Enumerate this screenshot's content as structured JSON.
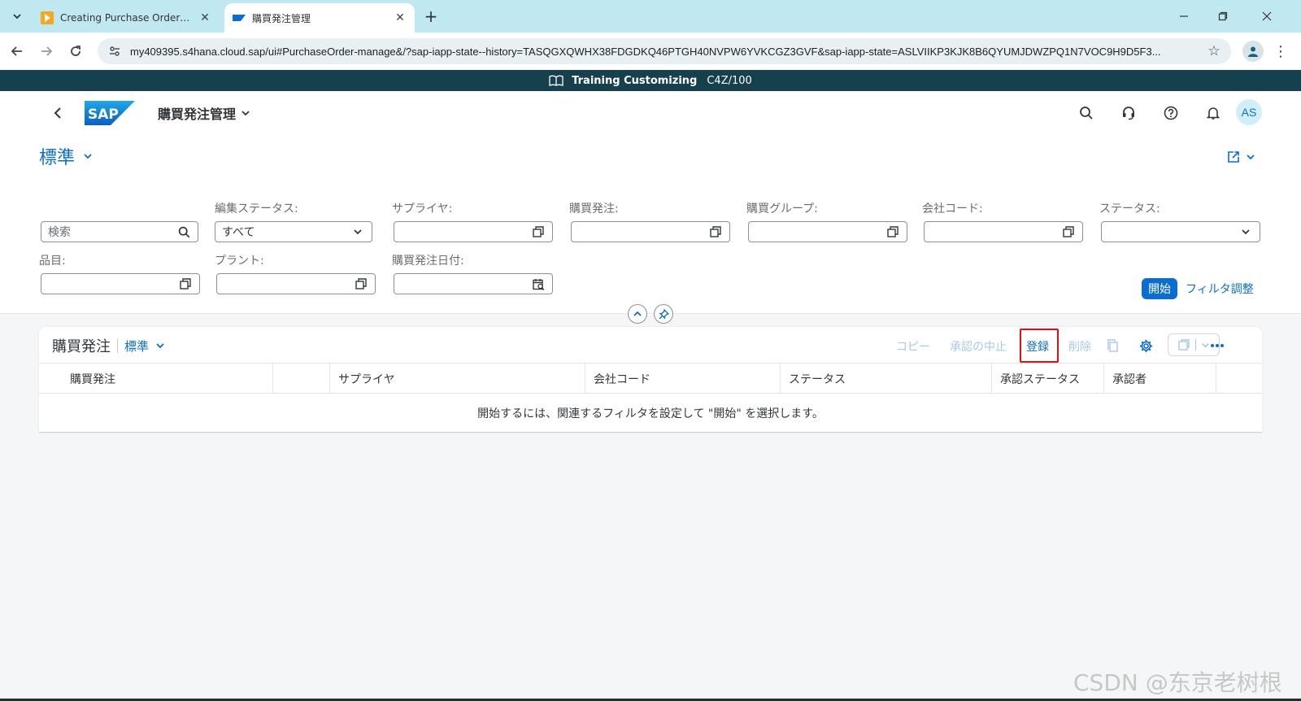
{
  "browser": {
    "tabs": [
      {
        "label": "Creating Purchase Orders (BMY",
        "active": false,
        "favicon": "play-icon"
      },
      {
        "label": "購買発注管理",
        "active": true,
        "favicon": "sap-icon"
      }
    ],
    "url": "my409395.s4hana.cloud.sap/ui#PurchaseOrder-manage&/?sap-iapp-state--history=TASQGXQWHX38FDGDKQ46PTGH40NVPW6YVKCGZ3GVF&sap-iapp-state=ASLVIIKP3KJK8B6QYUMJDWZPQ1N7VOC9H9D5F3..."
  },
  "system_banner": {
    "name": "Training Customizing",
    "client": "C4Z/100"
  },
  "shell": {
    "app_title": "購買発注管理",
    "avatar_initials": "AS"
  },
  "filter": {
    "variant": "標準",
    "search_placeholder": "検索",
    "fields": [
      {
        "label": "編集ステータス:",
        "value": "すべて"
      },
      {
        "label": "サプライヤ:",
        "value": ""
      },
      {
        "label": "購買発注:",
        "value": ""
      },
      {
        "label": "購買グループ:",
        "value": ""
      },
      {
        "label": "会社コード:",
        "value": ""
      },
      {
        "label": "ステータス:",
        "value": ""
      },
      {
        "label": "品目:",
        "value": ""
      },
      {
        "label": "プラント:",
        "value": ""
      },
      {
        "label": "購買発注日付:",
        "value": ""
      }
    ],
    "go_label": "開始",
    "adapt_label": "フィルタ調整"
  },
  "table": {
    "title": "購買発注",
    "variant": "標準",
    "toolbar": {
      "copy": "コピー",
      "cancel_approval": "承認の中止",
      "create": "登録",
      "delete": "削除"
    },
    "columns": [
      "購買発注",
      "",
      "サプライヤ",
      "会社コード",
      "ステータス",
      "承認ステータス",
      "承認者"
    ],
    "no_data_text": "開始するには、関連するフィルタを設定して \"開始\" を選択します。"
  },
  "watermark": "CSDN @东京老树根",
  "colors": {
    "accent": "#0a6ed1",
    "banner": "#17404f",
    "highlight": "#e01010",
    "tabbar": "#bfe8f0"
  }
}
